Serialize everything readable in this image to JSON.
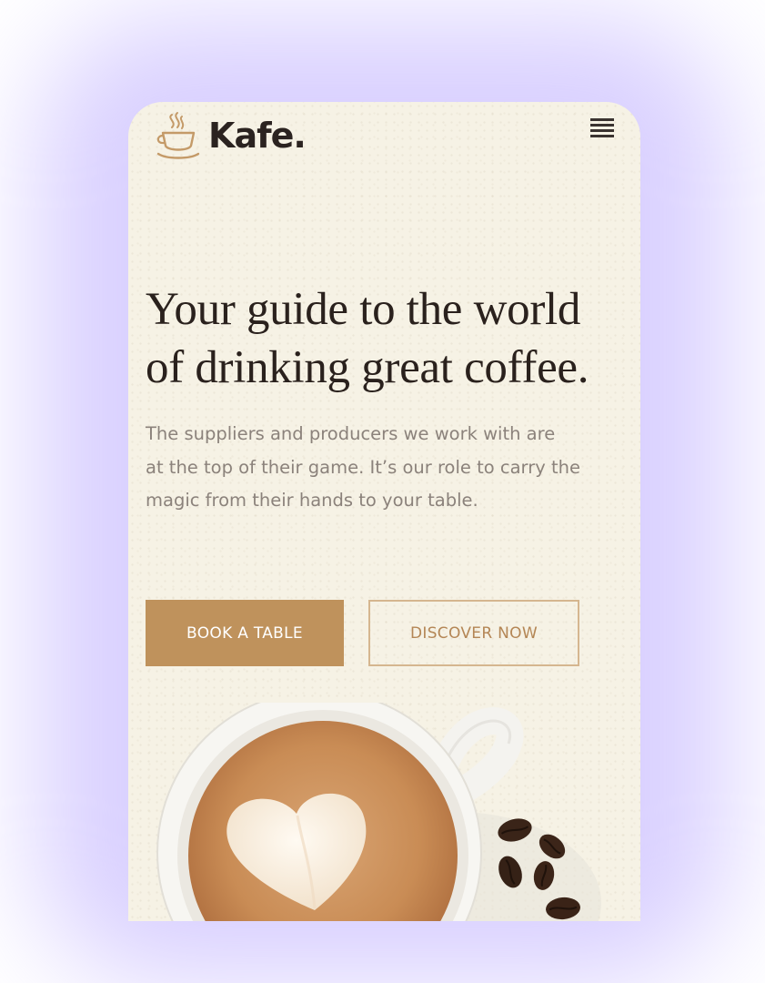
{
  "brand": {
    "name": "Kafe.",
    "icon": "coffee-cup-icon",
    "accent_color": "#bf925c",
    "text_color": "#2a211d"
  },
  "nav": {
    "menu_icon": "hamburger-menu-icon"
  },
  "hero": {
    "title_line1": "Your guide to the world",
    "title_line2": "of drinking great coffee.",
    "subtitle_line1": "The suppliers and producers we work with are",
    "subtitle_line2": "at the top of their game. It’s our role to carry the",
    "subtitle_line3": "magic from their hands to your table."
  },
  "actions": {
    "book_label": "BOOK A TABLE",
    "discover_label": "DISCOVER NOW"
  },
  "image": {
    "subject": "latte-cup-with-coffee-beans"
  }
}
